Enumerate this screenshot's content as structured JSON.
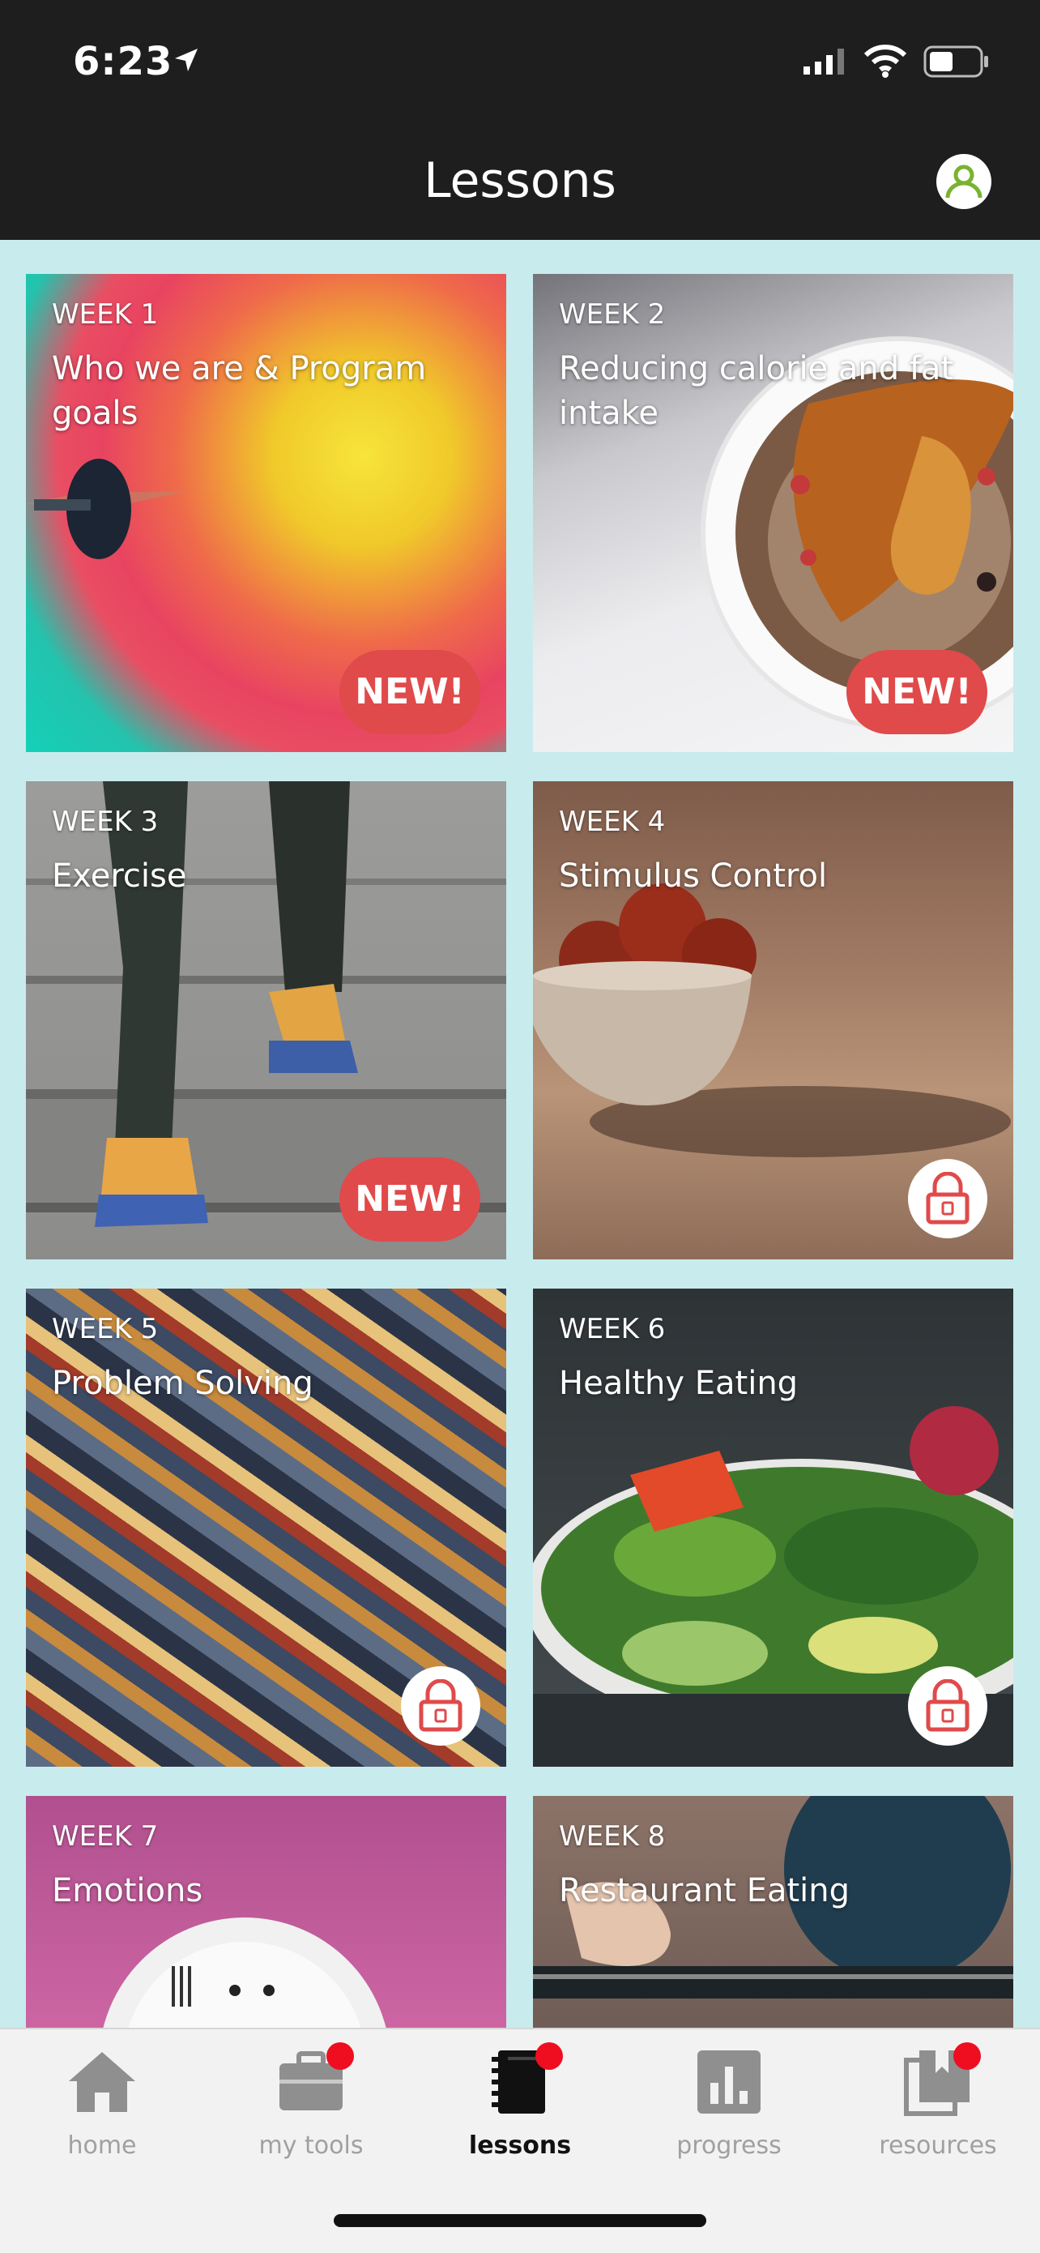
{
  "status_bar": {
    "time": "6:23"
  },
  "header": {
    "title": "Lessons"
  },
  "lessons": [
    {
      "week": "WEEK 1",
      "title": "Who we are & Program goals",
      "badge": "NEW!"
    },
    {
      "week": "WEEK 2",
      "title": "Reducing calorie and fat intake",
      "badge": "NEW!"
    },
    {
      "week": "WEEK 3",
      "title": "Exercise",
      "badge": "NEW!"
    },
    {
      "week": "WEEK 4",
      "title": "Stimulus Control",
      "locked": true
    },
    {
      "week": "WEEK 5",
      "title": "Problem Solving",
      "locked": true
    },
    {
      "week": "WEEK 6",
      "title": "Healthy Eating",
      "locked": true
    },
    {
      "week": "WEEK 7",
      "title": "Emotions"
    },
    {
      "week": "WEEK 8",
      "title": "Restaurant Eating"
    }
  ],
  "tabbar": {
    "tabs": [
      {
        "label": "home",
        "icon": "home-icon",
        "notification": false
      },
      {
        "label": "my tools",
        "icon": "toolbox-icon",
        "notification": true
      },
      {
        "label": "lessons",
        "icon": "notebook-icon",
        "notification": true,
        "active": true
      },
      {
        "label": "progress",
        "icon": "bar-chart-icon",
        "notification": false
      },
      {
        "label": "resources",
        "icon": "bookmark-icon",
        "notification": true
      }
    ]
  },
  "colors": {
    "accent_new_badge": "#e04a4a",
    "notification_dot": "#ee0e1f",
    "background": "#c8ecee",
    "header": "#1e1e1e"
  }
}
